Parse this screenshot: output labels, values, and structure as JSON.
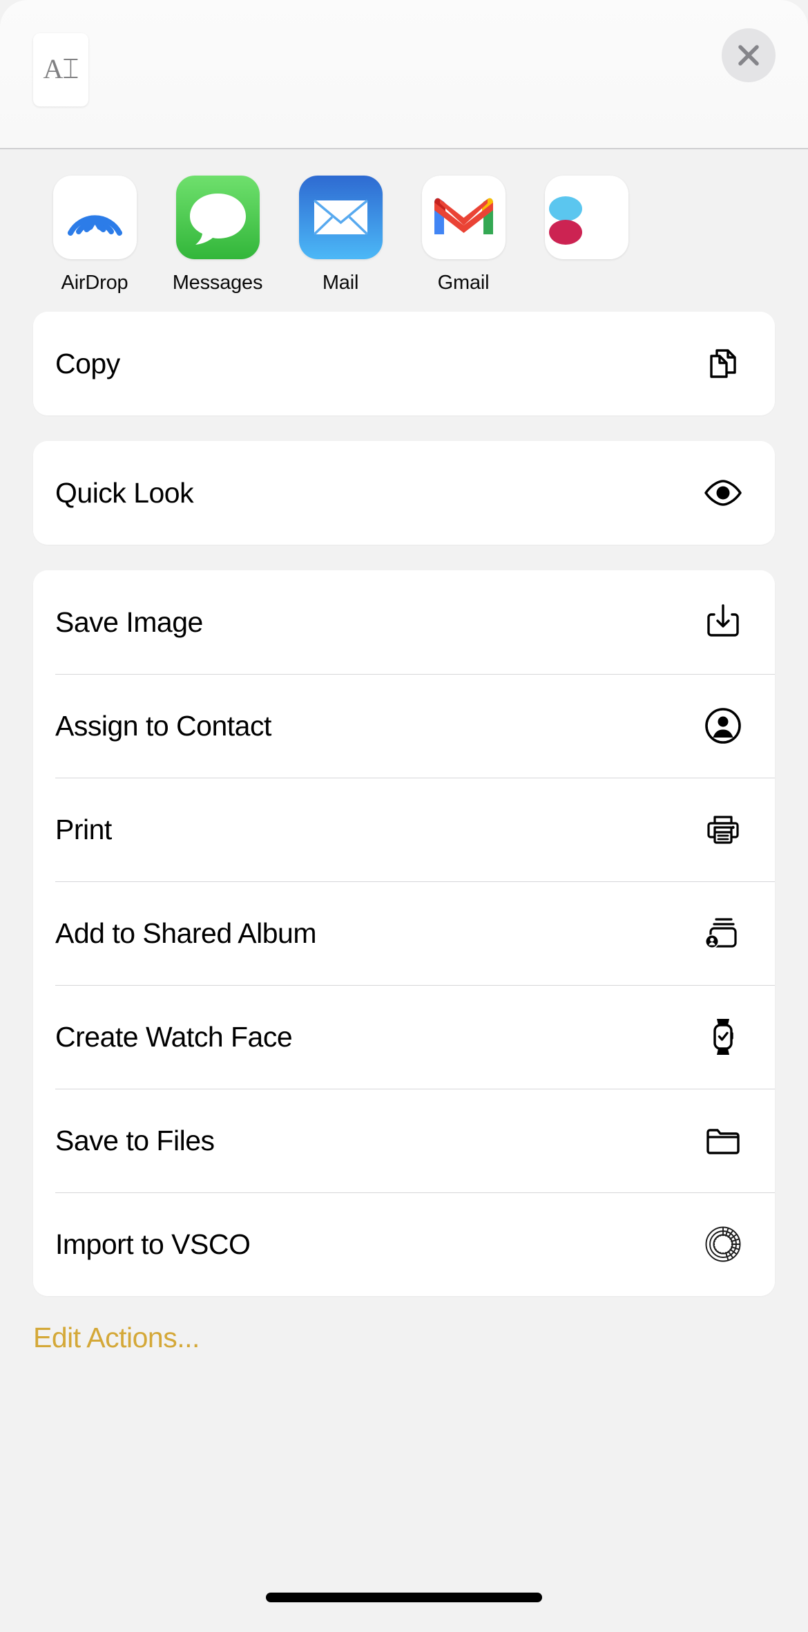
{
  "header": {
    "preview_glyph": "A⌶",
    "preview_name": "text-document-thumbnail",
    "close_label": "Close"
  },
  "share_targets": [
    {
      "label": "AirDrop",
      "icon": "airdrop-icon"
    },
    {
      "label": "Messages",
      "icon": "messages-icon"
    },
    {
      "label": "Mail",
      "icon": "mail-icon"
    },
    {
      "label": "Gmail",
      "icon": "gmail-icon"
    },
    {
      "label": "",
      "icon": "partial-app-icon"
    }
  ],
  "action_groups": [
    {
      "items": [
        {
          "label": "Copy",
          "icon": "copy-doc-on-doc-icon"
        }
      ]
    },
    {
      "items": [
        {
          "label": "Quick Look",
          "icon": "eye-icon"
        }
      ]
    },
    {
      "items": [
        {
          "label": "Save Image",
          "icon": "download-arrow-icon"
        },
        {
          "label": "Assign to Contact",
          "icon": "person-circle-icon"
        },
        {
          "label": "Print",
          "icon": "printer-icon"
        },
        {
          "label": "Add to Shared Album",
          "icon": "shared-album-icon"
        },
        {
          "label": "Create Watch Face",
          "icon": "apple-watch-icon"
        },
        {
          "label": "Save to Files",
          "icon": "folder-icon"
        },
        {
          "label": "Import to VSCO",
          "icon": "vsco-ring-icon"
        }
      ]
    }
  ],
  "edit_actions": {
    "label": "Edit Actions..."
  },
  "colors": {
    "accent": "#d4a838",
    "sheet_background": "#f2f2f2",
    "card_background": "#ffffff",
    "text_primary": "#000000",
    "close_button_background": "#e4e4e6",
    "messages_green": "#32b63a",
    "mail_blue": "#2e6ad1",
    "airdrop_blue": "#2c7ce8",
    "gmail_red": "#d93025",
    "gmail_blue": "#4285f4",
    "gmail_yellow": "#fbbc04",
    "gmail_green": "#34a853"
  }
}
